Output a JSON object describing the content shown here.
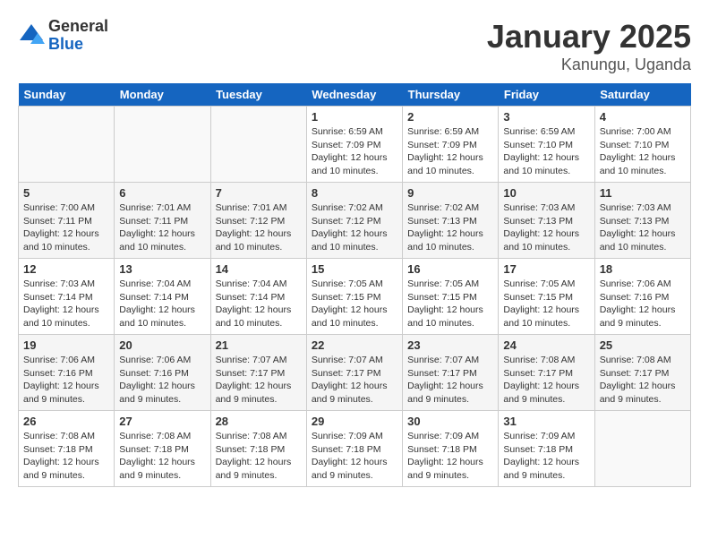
{
  "header": {
    "logo": {
      "general": "General",
      "blue": "Blue"
    },
    "title": "January 2025",
    "location": "Kanungu, Uganda"
  },
  "weekdays": [
    "Sunday",
    "Monday",
    "Tuesday",
    "Wednesday",
    "Thursday",
    "Friday",
    "Saturday"
  ],
  "weeks": [
    [
      {
        "day": "",
        "info": ""
      },
      {
        "day": "",
        "info": ""
      },
      {
        "day": "",
        "info": ""
      },
      {
        "day": "1",
        "info": "Sunrise: 6:59 AM\nSunset: 7:09 PM\nDaylight: 12 hours\nand 10 minutes."
      },
      {
        "day": "2",
        "info": "Sunrise: 6:59 AM\nSunset: 7:09 PM\nDaylight: 12 hours\nand 10 minutes."
      },
      {
        "day": "3",
        "info": "Sunrise: 6:59 AM\nSunset: 7:10 PM\nDaylight: 12 hours\nand 10 minutes."
      },
      {
        "day": "4",
        "info": "Sunrise: 7:00 AM\nSunset: 7:10 PM\nDaylight: 12 hours\nand 10 minutes."
      }
    ],
    [
      {
        "day": "5",
        "info": "Sunrise: 7:00 AM\nSunset: 7:11 PM\nDaylight: 12 hours\nand 10 minutes."
      },
      {
        "day": "6",
        "info": "Sunrise: 7:01 AM\nSunset: 7:11 PM\nDaylight: 12 hours\nand 10 minutes."
      },
      {
        "day": "7",
        "info": "Sunrise: 7:01 AM\nSunset: 7:12 PM\nDaylight: 12 hours\nand 10 minutes."
      },
      {
        "day": "8",
        "info": "Sunrise: 7:02 AM\nSunset: 7:12 PM\nDaylight: 12 hours\nand 10 minutes."
      },
      {
        "day": "9",
        "info": "Sunrise: 7:02 AM\nSunset: 7:13 PM\nDaylight: 12 hours\nand 10 minutes."
      },
      {
        "day": "10",
        "info": "Sunrise: 7:03 AM\nSunset: 7:13 PM\nDaylight: 12 hours\nand 10 minutes."
      },
      {
        "day": "11",
        "info": "Sunrise: 7:03 AM\nSunset: 7:13 PM\nDaylight: 12 hours\nand 10 minutes."
      }
    ],
    [
      {
        "day": "12",
        "info": "Sunrise: 7:03 AM\nSunset: 7:14 PM\nDaylight: 12 hours\nand 10 minutes."
      },
      {
        "day": "13",
        "info": "Sunrise: 7:04 AM\nSunset: 7:14 PM\nDaylight: 12 hours\nand 10 minutes."
      },
      {
        "day": "14",
        "info": "Sunrise: 7:04 AM\nSunset: 7:14 PM\nDaylight: 12 hours\nand 10 minutes."
      },
      {
        "day": "15",
        "info": "Sunrise: 7:05 AM\nSunset: 7:15 PM\nDaylight: 12 hours\nand 10 minutes."
      },
      {
        "day": "16",
        "info": "Sunrise: 7:05 AM\nSunset: 7:15 PM\nDaylight: 12 hours\nand 10 minutes."
      },
      {
        "day": "17",
        "info": "Sunrise: 7:05 AM\nSunset: 7:15 PM\nDaylight: 12 hours\nand 10 minutes."
      },
      {
        "day": "18",
        "info": "Sunrise: 7:06 AM\nSunset: 7:16 PM\nDaylight: 12 hours\nand 9 minutes."
      }
    ],
    [
      {
        "day": "19",
        "info": "Sunrise: 7:06 AM\nSunset: 7:16 PM\nDaylight: 12 hours\nand 9 minutes."
      },
      {
        "day": "20",
        "info": "Sunrise: 7:06 AM\nSunset: 7:16 PM\nDaylight: 12 hours\nand 9 minutes."
      },
      {
        "day": "21",
        "info": "Sunrise: 7:07 AM\nSunset: 7:17 PM\nDaylight: 12 hours\nand 9 minutes."
      },
      {
        "day": "22",
        "info": "Sunrise: 7:07 AM\nSunset: 7:17 PM\nDaylight: 12 hours\nand 9 minutes."
      },
      {
        "day": "23",
        "info": "Sunrise: 7:07 AM\nSunset: 7:17 PM\nDaylight: 12 hours\nand 9 minutes."
      },
      {
        "day": "24",
        "info": "Sunrise: 7:08 AM\nSunset: 7:17 PM\nDaylight: 12 hours\nand 9 minutes."
      },
      {
        "day": "25",
        "info": "Sunrise: 7:08 AM\nSunset: 7:17 PM\nDaylight: 12 hours\nand 9 minutes."
      }
    ],
    [
      {
        "day": "26",
        "info": "Sunrise: 7:08 AM\nSunset: 7:18 PM\nDaylight: 12 hours\nand 9 minutes."
      },
      {
        "day": "27",
        "info": "Sunrise: 7:08 AM\nSunset: 7:18 PM\nDaylight: 12 hours\nand 9 minutes."
      },
      {
        "day": "28",
        "info": "Sunrise: 7:08 AM\nSunset: 7:18 PM\nDaylight: 12 hours\nand 9 minutes."
      },
      {
        "day": "29",
        "info": "Sunrise: 7:09 AM\nSunset: 7:18 PM\nDaylight: 12 hours\nand 9 minutes."
      },
      {
        "day": "30",
        "info": "Sunrise: 7:09 AM\nSunset: 7:18 PM\nDaylight: 12 hours\nand 9 minutes."
      },
      {
        "day": "31",
        "info": "Sunrise: 7:09 AM\nSunset: 7:18 PM\nDaylight: 12 hours\nand 9 minutes."
      },
      {
        "day": "",
        "info": ""
      }
    ]
  ]
}
